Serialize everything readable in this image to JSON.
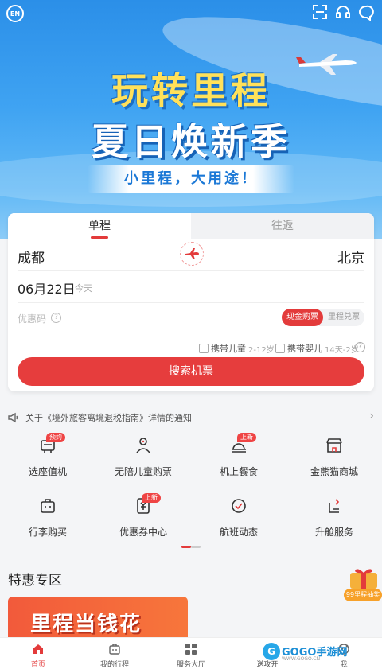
{
  "banner": {
    "headline_1": "玩转里程",
    "headline_2": "夏日焕新季",
    "slogan": "小里程，大用途！",
    "colors": {
      "sky": "#2b8fe8",
      "headline_yellow": "#ffe15a"
    }
  },
  "header_icons": {
    "language": "EN",
    "icons": [
      "language-icon",
      "scan-icon",
      "customer-service-icon",
      "message-icon"
    ]
  },
  "booking": {
    "tabs": [
      {
        "label": "单程",
        "active": true
      },
      {
        "label": "往返",
        "active": false
      }
    ],
    "from_city": "成都",
    "to_city": "北京",
    "date": "06月22日",
    "date_note": "今天",
    "promo_placeholder": "优惠码",
    "pay_cash": "现金购票",
    "pay_miles": "里程兑票",
    "child_label": "携带儿童",
    "child_age": "2-12岁",
    "infant_label": "携带婴儿",
    "infant_age": "14天-2岁",
    "search_button": "搜索机票",
    "accent": "#e33b3b"
  },
  "notice": {
    "text": "关于《境外旅客离境退税指南》详情的通知"
  },
  "services": [
    {
      "label": "选座值机",
      "badge": "预约",
      "icon": "seat-checkin-icon"
    },
    {
      "label": "无陪儿童购票",
      "badge": "",
      "icon": "unaccompanied-child-icon"
    },
    {
      "label": "机上餐食",
      "badge": "上新",
      "icon": "meal-icon"
    },
    {
      "label": "金熊猫商城",
      "badge": "",
      "icon": "mall-icon"
    },
    {
      "label": "行李购买",
      "badge": "",
      "icon": "luggage-icon"
    },
    {
      "label": "优惠券中心",
      "badge": "上新",
      "icon": "coupon-icon"
    },
    {
      "label": "航班动态",
      "badge": "",
      "icon": "flight-status-icon"
    },
    {
      "label": "升舱服务",
      "badge": "",
      "icon": "upgrade-icon"
    }
  ],
  "special": {
    "title": "特惠专区",
    "promo_text": "里程当钱花",
    "gift_label": "99里程抽奖"
  },
  "nav": {
    "items": [
      {
        "label": "首页",
        "active": true,
        "icon": "home-icon"
      },
      {
        "label": "我的行程",
        "active": false,
        "icon": "trip-icon"
      },
      {
        "label": "服务大厅",
        "active": false,
        "icon": "services-icon"
      },
      {
        "label": "送攻开",
        "active": false,
        "icon": "explore-icon"
      },
      {
        "label": "我",
        "active": false,
        "icon": "profile-icon"
      }
    ]
  },
  "watermark": {
    "logo": "G",
    "text": "GOGO手游网",
    "sub": "WWW.GOGO.CN"
  }
}
